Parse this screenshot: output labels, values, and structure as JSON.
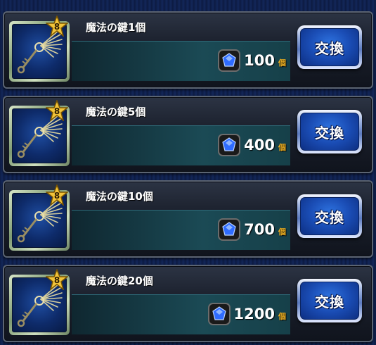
{
  "items": [
    {
      "name": "魔法の鍵1個",
      "rank": "8",
      "price": "100",
      "unit": "個",
      "button": "交換"
    },
    {
      "name": "魔法の鍵5個",
      "rank": "8",
      "price": "400",
      "unit": "個",
      "button": "交換"
    },
    {
      "name": "魔法の鍵10個",
      "rank": "8",
      "price": "700",
      "unit": "個",
      "button": "交換"
    },
    {
      "name": "魔法の鍵20個",
      "rank": "8",
      "price": "1200",
      "unit": "個",
      "button": "交換"
    }
  ],
  "icons": {
    "item": "magic-key-icon",
    "rank": "star-icon",
    "currency": "blue-gem-icon"
  },
  "colors": {
    "button_blue": "#1a4cb4",
    "unit_gold": "#f0b020",
    "item_bg_blue": "#0e2b6a"
  }
}
